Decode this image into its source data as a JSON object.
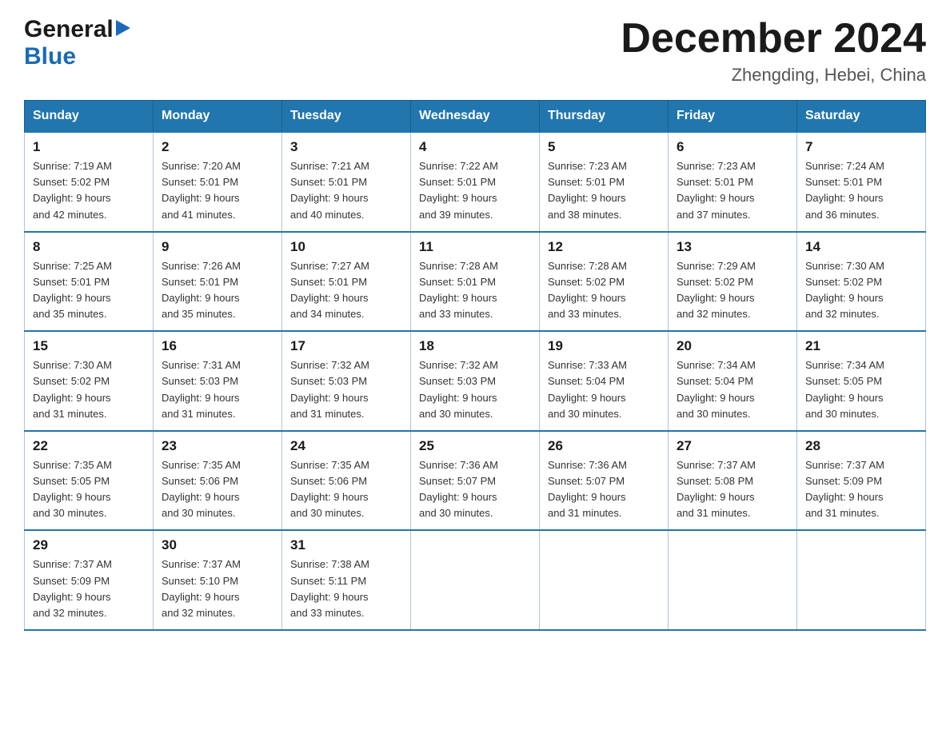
{
  "header": {
    "logo_general": "General",
    "logo_blue": "Blue",
    "month_title": "December 2024",
    "location": "Zhengding, Hebei, China"
  },
  "calendar": {
    "days_of_week": [
      "Sunday",
      "Monday",
      "Tuesday",
      "Wednesday",
      "Thursday",
      "Friday",
      "Saturday"
    ],
    "weeks": [
      [
        {
          "day": "1",
          "sunrise": "7:19 AM",
          "sunset": "5:02 PM",
          "daylight": "9 hours and 42 minutes."
        },
        {
          "day": "2",
          "sunrise": "7:20 AM",
          "sunset": "5:01 PM",
          "daylight": "9 hours and 41 minutes."
        },
        {
          "day": "3",
          "sunrise": "7:21 AM",
          "sunset": "5:01 PM",
          "daylight": "9 hours and 40 minutes."
        },
        {
          "day": "4",
          "sunrise": "7:22 AM",
          "sunset": "5:01 PM",
          "daylight": "9 hours and 39 minutes."
        },
        {
          "day": "5",
          "sunrise": "7:23 AM",
          "sunset": "5:01 PM",
          "daylight": "9 hours and 38 minutes."
        },
        {
          "day": "6",
          "sunrise": "7:23 AM",
          "sunset": "5:01 PM",
          "daylight": "9 hours and 37 minutes."
        },
        {
          "day": "7",
          "sunrise": "7:24 AM",
          "sunset": "5:01 PM",
          "daylight": "9 hours and 36 minutes."
        }
      ],
      [
        {
          "day": "8",
          "sunrise": "7:25 AM",
          "sunset": "5:01 PM",
          "daylight": "9 hours and 35 minutes."
        },
        {
          "day": "9",
          "sunrise": "7:26 AM",
          "sunset": "5:01 PM",
          "daylight": "9 hours and 35 minutes."
        },
        {
          "day": "10",
          "sunrise": "7:27 AM",
          "sunset": "5:01 PM",
          "daylight": "9 hours and 34 minutes."
        },
        {
          "day": "11",
          "sunrise": "7:28 AM",
          "sunset": "5:01 PM",
          "daylight": "9 hours and 33 minutes."
        },
        {
          "day": "12",
          "sunrise": "7:28 AM",
          "sunset": "5:02 PM",
          "daylight": "9 hours and 33 minutes."
        },
        {
          "day": "13",
          "sunrise": "7:29 AM",
          "sunset": "5:02 PM",
          "daylight": "9 hours and 32 minutes."
        },
        {
          "day": "14",
          "sunrise": "7:30 AM",
          "sunset": "5:02 PM",
          "daylight": "9 hours and 32 minutes."
        }
      ],
      [
        {
          "day": "15",
          "sunrise": "7:30 AM",
          "sunset": "5:02 PM",
          "daylight": "9 hours and 31 minutes."
        },
        {
          "day": "16",
          "sunrise": "7:31 AM",
          "sunset": "5:03 PM",
          "daylight": "9 hours and 31 minutes."
        },
        {
          "day": "17",
          "sunrise": "7:32 AM",
          "sunset": "5:03 PM",
          "daylight": "9 hours and 31 minutes."
        },
        {
          "day": "18",
          "sunrise": "7:32 AM",
          "sunset": "5:03 PM",
          "daylight": "9 hours and 30 minutes."
        },
        {
          "day": "19",
          "sunrise": "7:33 AM",
          "sunset": "5:04 PM",
          "daylight": "9 hours and 30 minutes."
        },
        {
          "day": "20",
          "sunrise": "7:34 AM",
          "sunset": "5:04 PM",
          "daylight": "9 hours and 30 minutes."
        },
        {
          "day": "21",
          "sunrise": "7:34 AM",
          "sunset": "5:05 PM",
          "daylight": "9 hours and 30 minutes."
        }
      ],
      [
        {
          "day": "22",
          "sunrise": "7:35 AM",
          "sunset": "5:05 PM",
          "daylight": "9 hours and 30 minutes."
        },
        {
          "day": "23",
          "sunrise": "7:35 AM",
          "sunset": "5:06 PM",
          "daylight": "9 hours and 30 minutes."
        },
        {
          "day": "24",
          "sunrise": "7:35 AM",
          "sunset": "5:06 PM",
          "daylight": "9 hours and 30 minutes."
        },
        {
          "day": "25",
          "sunrise": "7:36 AM",
          "sunset": "5:07 PM",
          "daylight": "9 hours and 30 minutes."
        },
        {
          "day": "26",
          "sunrise": "7:36 AM",
          "sunset": "5:07 PM",
          "daylight": "9 hours and 31 minutes."
        },
        {
          "day": "27",
          "sunrise": "7:37 AM",
          "sunset": "5:08 PM",
          "daylight": "9 hours and 31 minutes."
        },
        {
          "day": "28",
          "sunrise": "7:37 AM",
          "sunset": "5:09 PM",
          "daylight": "9 hours and 31 minutes."
        }
      ],
      [
        {
          "day": "29",
          "sunrise": "7:37 AM",
          "sunset": "5:09 PM",
          "daylight": "9 hours and 32 minutes."
        },
        {
          "day": "30",
          "sunrise": "7:37 AM",
          "sunset": "5:10 PM",
          "daylight": "9 hours and 32 minutes."
        },
        {
          "day": "31",
          "sunrise": "7:38 AM",
          "sunset": "5:11 PM",
          "daylight": "9 hours and 33 minutes."
        },
        null,
        null,
        null,
        null
      ]
    ],
    "sunrise_label": "Sunrise:",
    "sunset_label": "Sunset:",
    "daylight_label": "Daylight:"
  }
}
